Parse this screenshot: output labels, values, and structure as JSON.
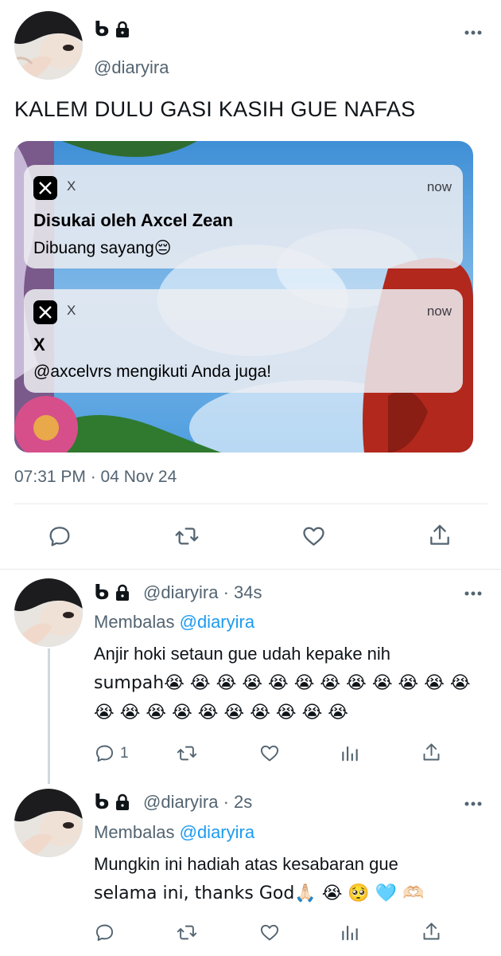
{
  "colors": {
    "text": "#0f1419",
    "secondary": "#536471",
    "link": "#1d9bf0",
    "divider": "#e6e9ec"
  },
  "main_tweet": {
    "name_glyph": "ᑲ",
    "handle": "@diaryira",
    "text": "KALEM DULU GASI KASIH GUE NAFAS",
    "timestamp": "07:31 PM · 04 Nov 24",
    "notifications": [
      {
        "app": "X",
        "time": "now",
        "title": "Disukai oleh Axcel Zean",
        "body": "Dibuang sayang😔"
      },
      {
        "app": "X",
        "time": "now",
        "title": "X",
        "body": "@axcelvrs mengikuti Anda juga!"
      }
    ],
    "actions": [
      "reply-icon",
      "retweet-icon",
      "like-icon",
      "share-icon"
    ]
  },
  "replies": [
    {
      "name_glyph": "ᑲ",
      "handle": "@diaryira",
      "age": "34s",
      "replying_label": "Membalas",
      "replying_to": "@diaryira",
      "line1": "Anjir hoki setaun gue udah kepake nih",
      "line2": "sumpah😭 😭 😭 😭 😭 😭 😭 😭 😭 😭 😭 😭",
      "line3": "😭 😭 😭 😭 😭 😭 😭 😭 😭 😭",
      "reply_count": "1"
    },
    {
      "name_glyph": "ᑲ",
      "handle": "@diaryira",
      "age": "2s",
      "replying_label": "Membalas",
      "replying_to": "@diaryira",
      "line1": "Mungkin ini hadiah atas kesabaran gue",
      "line2": "selama ini, thanks God🙏🏻 😭 🥺 🩵 🫶🏻",
      "reply_count": ""
    }
  ]
}
